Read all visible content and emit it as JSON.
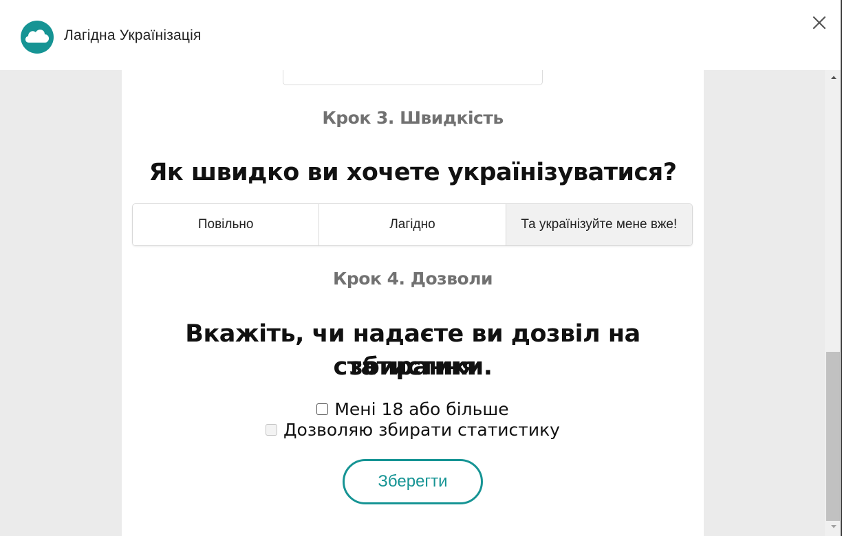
{
  "app": {
    "title": "Лагідна Українізація",
    "logo_icon": "cloud-icon",
    "accent_color": "#169494"
  },
  "step3": {
    "label": "Крок 3. Швидкість",
    "question": "Як швидко ви хочете українізуватися?",
    "options": [
      {
        "label": "Повільно",
        "selected": false
      },
      {
        "label": "Лагідно",
        "selected": false
      },
      {
        "label": "Та українізуйте мене вже!",
        "selected": true
      }
    ]
  },
  "step4": {
    "label": "Крок 4. Дозволи",
    "question_line1": "Вкажіть, чи надаєте ви дозвіл на збирання",
    "question_line2": "статистики.",
    "checkboxes": [
      {
        "label": "Мені 18 або більше",
        "checked": false,
        "disabled": false
      },
      {
        "label": "Дозволяю збирати статистику",
        "checked": false,
        "disabled": true
      }
    ]
  },
  "save_label": "Зберегти"
}
